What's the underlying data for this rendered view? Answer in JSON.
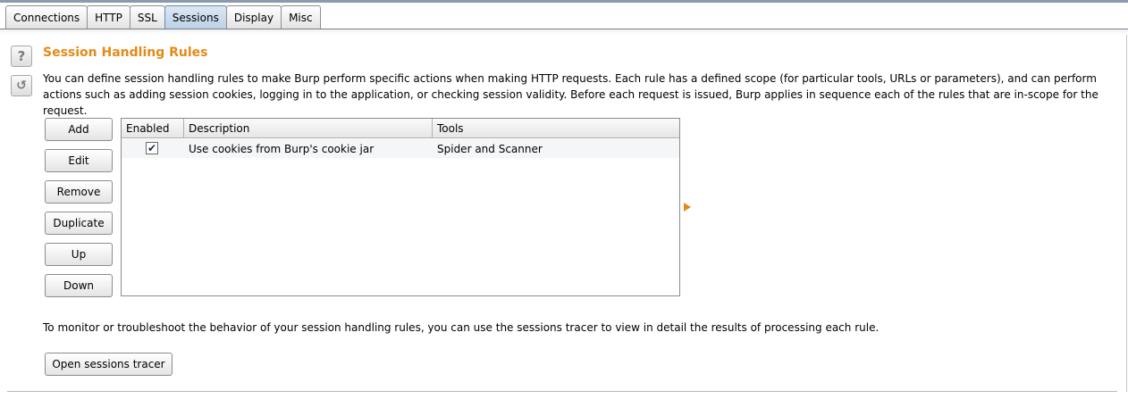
{
  "tabs": [
    {
      "label": "Connections",
      "active": false
    },
    {
      "label": "HTTP",
      "active": false
    },
    {
      "label": "SSL",
      "active": false
    },
    {
      "label": "Sessions",
      "active": true
    },
    {
      "label": "Display",
      "active": false
    },
    {
      "label": "Misc",
      "active": false
    }
  ],
  "icons": {
    "help": "?",
    "refresh": "↺",
    "expand": "expand-arrow-icon"
  },
  "section": {
    "title": "Session Handling Rules",
    "description": "You can define session handling rules to make Burp perform specific actions when making HTTP requests. Each rule has a defined scope (for particular tools, URLs or parameters), and can perform actions such as adding session cookies, logging in to the application, or checking session validity. Before each request is issued, Burp applies in sequence each of the rules that are in-scope for the request."
  },
  "buttons": {
    "add": "Add",
    "edit": "Edit",
    "remove": "Remove",
    "duplicate": "Duplicate",
    "up": "Up",
    "down": "Down"
  },
  "table": {
    "headers": {
      "enabled": "Enabled",
      "description": "Description",
      "tools": "Tools"
    },
    "rows": [
      {
        "enabled": true,
        "description": "Use cookies from Burp's cookie jar",
        "tools": "Spider and Scanner"
      }
    ]
  },
  "tracer": {
    "text": "To monitor or troubleshoot the behavior of your session handling rules, you can use the sessions tracer to view in detail the results of processing each rule.",
    "button": "Open sessions tracer"
  },
  "colors": {
    "accent": "#e58a16",
    "active_tab": "#bcd0e6"
  }
}
